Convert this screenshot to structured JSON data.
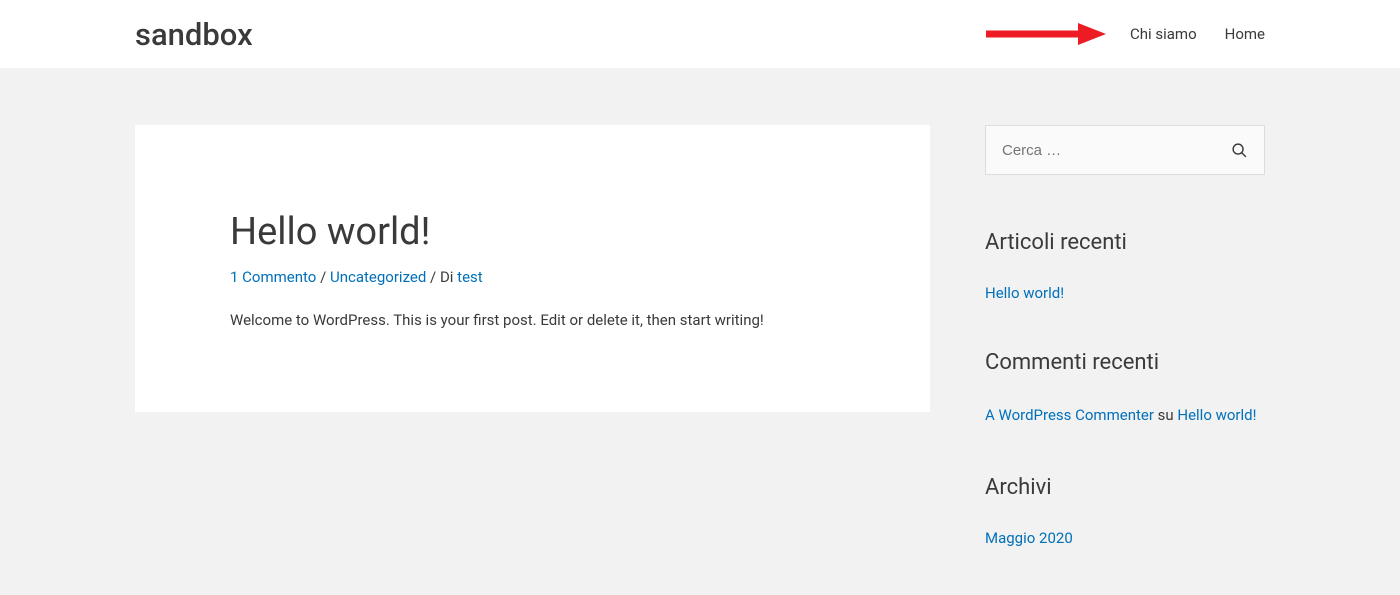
{
  "header": {
    "site_title": "sandbox",
    "nav": [
      {
        "label": "Chi siamo"
      },
      {
        "label": "Home"
      }
    ]
  },
  "post": {
    "title": "Hello world!",
    "meta": {
      "comments_label": "1 Commento",
      "sep1": " / ",
      "category": "Uncategorized",
      "sep2": " / ",
      "by_label": "Di ",
      "author": "test"
    },
    "body": "Welcome to WordPress. This is your first post. Edit or delete it, then start writing!"
  },
  "sidebar": {
    "search": {
      "placeholder": "Cerca …"
    },
    "recent_posts": {
      "title": "Articoli recenti",
      "items": [
        {
          "label": "Hello world!"
        }
      ]
    },
    "recent_comments": {
      "title": "Commenti recenti",
      "items": [
        {
          "author": "A WordPress Commenter",
          "on_label": " su ",
          "post": "Hello world!"
        }
      ]
    },
    "archives": {
      "title": "Archivi",
      "items": [
        {
          "label": "Maggio 2020"
        }
      ]
    }
  }
}
